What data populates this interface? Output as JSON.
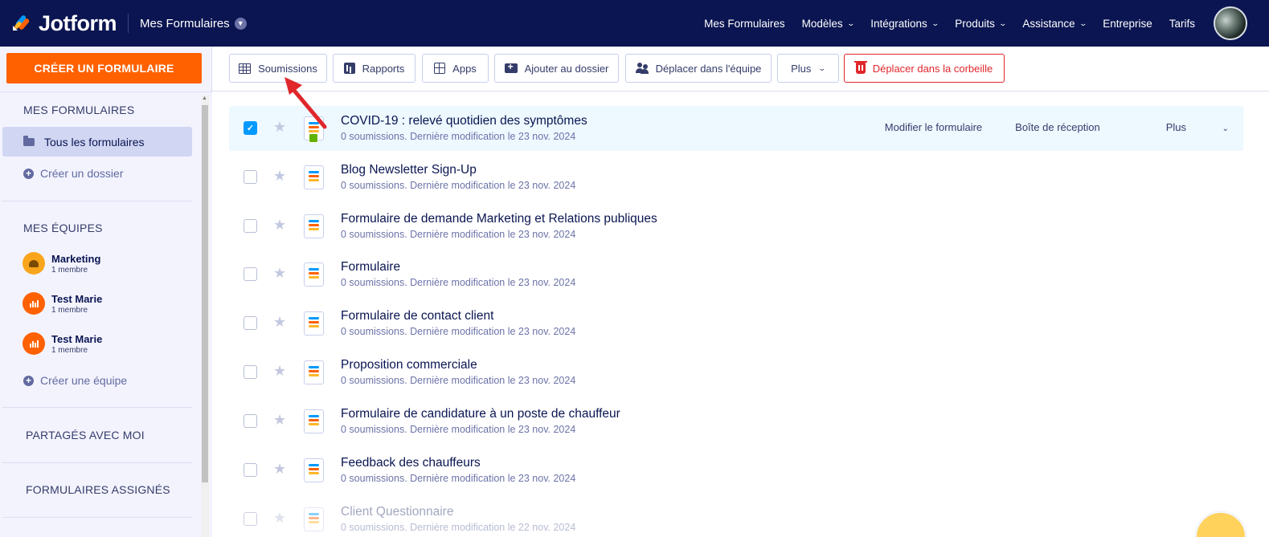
{
  "header": {
    "logo_text": "Jotform",
    "workspace": "Mes Formulaires",
    "nav": [
      {
        "label": "Mes Formulaires",
        "dropdown": false
      },
      {
        "label": "Modèles",
        "dropdown": true
      },
      {
        "label": "Intégrations",
        "dropdown": true
      },
      {
        "label": "Produits",
        "dropdown": true
      },
      {
        "label": "Assistance",
        "dropdown": true
      },
      {
        "label": "Entreprise",
        "dropdown": false
      },
      {
        "label": "Tarifs",
        "dropdown": false
      }
    ]
  },
  "sidebar": {
    "create_label": "CRÉER UN FORMULAIRE",
    "my_forms_title": "MES FORMULAIRES",
    "all_forms": "Tous les formulaires",
    "create_folder": "Créer un dossier",
    "teams_title": "MES ÉQUIPES",
    "teams": [
      {
        "name": "Marketing",
        "members": "1 membre",
        "color": "#f9a51c"
      },
      {
        "name": "Test Marie",
        "members": "1 membre",
        "color": "#ff6100"
      },
      {
        "name": "Test Marie",
        "members": "1 membre",
        "color": "#ff6100"
      }
    ],
    "create_team": "Créer une équipe",
    "shared_title": "PARTAGÉS AVEC MOI",
    "assigned_title": "FORMULAIRES ASSIGNÉS"
  },
  "toolbar": {
    "submissions": "Soumissions",
    "reports": "Rapports",
    "apps": "Apps",
    "add_folder": "Ajouter au dossier",
    "move_team": "Déplacer dans l'équipe",
    "more": "Plus",
    "trash": "Déplacer dans la corbeille"
  },
  "row_actions": {
    "edit": "Modifier le formulaire",
    "inbox": "Boîte de réception",
    "more": "Plus"
  },
  "forms": [
    {
      "title": "COVID-19 : relevé quotidien des symptômes",
      "meta": "0 soumissions. Dernière modification le 23 nov. 2024",
      "selected": true
    },
    {
      "title": "Blog Newsletter Sign-Up",
      "meta": "0 soumissions. Dernière modification le 23 nov. 2024",
      "selected": false
    },
    {
      "title": "Formulaire de demande Marketing et Relations publiques",
      "meta": "0 soumissions. Dernière modification le 23 nov. 2024",
      "selected": false
    },
    {
      "title": "Formulaire",
      "meta": "0 soumissions. Dernière modification le 23 nov. 2024",
      "selected": false
    },
    {
      "title": "Formulaire de contact client",
      "meta": "0 soumissions. Dernière modification le 23 nov. 2024",
      "selected": false
    },
    {
      "title": "Proposition commerciale",
      "meta": "0 soumissions. Dernière modification le 23 nov. 2024",
      "selected": false
    },
    {
      "title": "Formulaire de candidature à un poste de chauffeur",
      "meta": "0 soumissions. Dernière modification le 23 nov. 2024",
      "selected": false
    },
    {
      "title": "Feedback des chauffeurs",
      "meta": "0 soumissions. Dernière modification le 23 nov. 2024",
      "selected": false
    },
    {
      "title": "Client Questionnaire",
      "meta": "0 soumissions. Dernière modification le 22 nov. 2024",
      "selected": false
    }
  ],
  "colors": {
    "navbar": "#0a1551",
    "accent": "#ff6100",
    "selected_row": "#edf8ff",
    "checkbox": "#0099ff",
    "danger": "#e0272c",
    "annotation_arrow": "#e0272c"
  }
}
